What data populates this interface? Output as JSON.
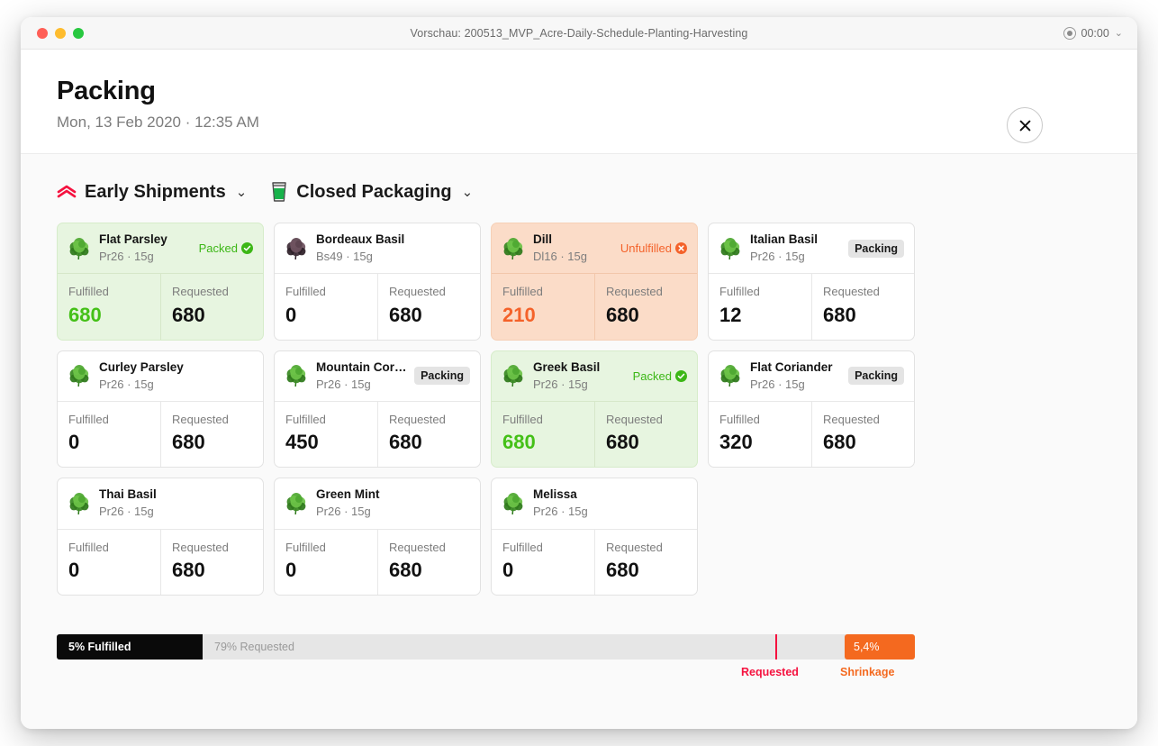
{
  "window": {
    "title": "Vorschau: 200513_MVP_Acre-Daily-Schedule-Planting-Harvesting",
    "timer": "00:00",
    "timer_caret": "⌄",
    "traffic_lights": [
      "close-red",
      "minimize-yellow",
      "maximize-green"
    ]
  },
  "header": {
    "title": "Packing",
    "subtitle": "Mon, 13 Feb 2020 · 12:35 AM",
    "close_icon": "close-icon"
  },
  "filters": [
    {
      "icon": "early-shipments-icon",
      "label": "Early Shipments",
      "caret": "⌄"
    },
    {
      "icon": "closed-packaging-icon",
      "label": "Closed Packaging",
      "caret": "⌄"
    }
  ],
  "labels": {
    "fulfilled": "Fulfilled",
    "requested": "Requested"
  },
  "cards": [
    {
      "name": "Flat Parsley",
      "meta": "Pr26 · 15g",
      "state": "packed",
      "badge": "Packed",
      "badge_type": "status",
      "badge_icon": "check-circle-icon",
      "fulfilled": "680",
      "requested": "680",
      "herb": "green"
    },
    {
      "name": "Bordeaux Basil",
      "meta": "Bs49 · 15g",
      "state": "plain",
      "badge": "",
      "badge_type": "none",
      "badge_icon": "",
      "fulfilled": "0",
      "requested": "680",
      "herb": "purple"
    },
    {
      "name": "Dill",
      "meta": "Dl16 · 15g",
      "state": "unfulfilled",
      "badge": "Unfulfilled",
      "badge_type": "status",
      "badge_icon": "x-circle-icon",
      "fulfilled": "210",
      "requested": "680",
      "herb": "green"
    },
    {
      "name": "Italian Basil",
      "meta": "Pr26 · 15g",
      "state": "plain",
      "badge": "Packing",
      "badge_type": "pill",
      "badge_icon": "",
      "fulfilled": "12",
      "requested": "680",
      "herb": "green"
    },
    {
      "name": "Curley Parsley",
      "meta": "Pr26 · 15g",
      "state": "plain",
      "badge": "",
      "badge_type": "none",
      "badge_icon": "",
      "fulfilled": "0",
      "requested": "680",
      "herb": "green"
    },
    {
      "name": "Mountain Cori…",
      "meta": "Pr26 · 15g",
      "state": "plain",
      "badge": "Packing",
      "badge_type": "pill",
      "badge_icon": "",
      "fulfilled": "450",
      "requested": "680",
      "herb": "green"
    },
    {
      "name": "Greek Basil",
      "meta": "Pr26 · 15g",
      "state": "packed",
      "badge": "Packed",
      "badge_type": "status",
      "badge_icon": "check-circle-icon",
      "fulfilled": "680",
      "requested": "680",
      "herb": "green"
    },
    {
      "name": "Flat Coriander",
      "meta": "Pr26 · 15g",
      "state": "plain",
      "badge": "Packing",
      "badge_type": "pill",
      "badge_icon": "",
      "fulfilled": "320",
      "requested": "680",
      "herb": "green"
    },
    {
      "name": "Thai Basil",
      "meta": "Pr26 · 15g",
      "state": "plain",
      "badge": "",
      "badge_type": "none",
      "badge_icon": "",
      "fulfilled": "0",
      "requested": "680",
      "herb": "green"
    },
    {
      "name": "Green Mint",
      "meta": "Pr26 · 15g",
      "state": "plain",
      "badge": "",
      "badge_type": "none",
      "badge_icon": "",
      "fulfilled": "0",
      "requested": "680",
      "herb": "green"
    },
    {
      "name": "Melissa",
      "meta": "Pr26 · 15g",
      "state": "plain",
      "badge": "",
      "badge_type": "none",
      "badge_icon": "",
      "fulfilled": "0",
      "requested": "680",
      "herb": "green"
    }
  ],
  "progress": {
    "fulfilled_label": "5% Fulfilled",
    "requested_label": "79% Requested",
    "shrinkage_label": "5,4%",
    "marker_label": "Requested",
    "shrinkage_axis_label": "Shrinkage",
    "fulfilled_pct": 5,
    "requested_pct": 79,
    "shrinkage_pct": 5.4,
    "colors": {
      "fulfilled": "#0a0a0a",
      "track": "#e6e6e6",
      "marker": "#f5123f",
      "shrinkage": "#f4691f"
    }
  },
  "colors": {
    "packed_bg": "#e7f5e0",
    "unfulfilled_bg": "#fbdcc8",
    "packed_text": "#3cb716",
    "unfulfilled_text": "#f4622a",
    "value_green": "#44c017",
    "value_orange": "#f4622a"
  }
}
